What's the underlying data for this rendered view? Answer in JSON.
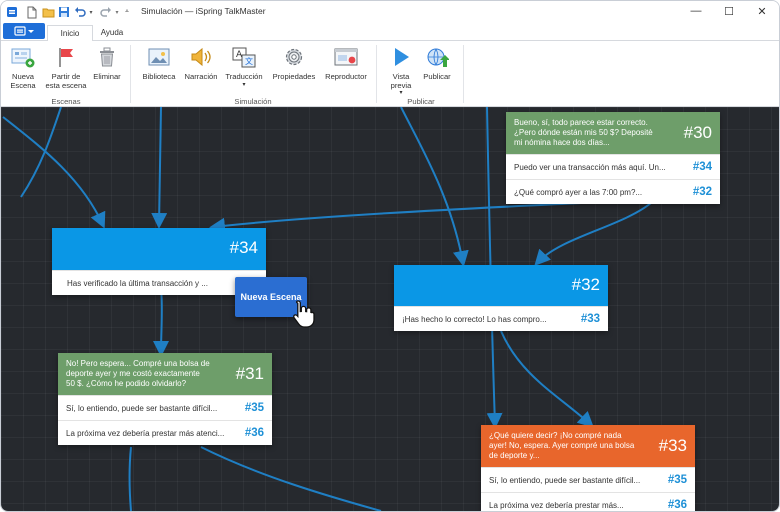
{
  "window": {
    "title": "Simulación — iSpring TalkMaster",
    "controls": {
      "minimize": "—",
      "maximize": "☐",
      "close": "✕"
    }
  },
  "tabs": [
    {
      "label": "Inicio"
    },
    {
      "label": "Ayuda"
    }
  ],
  "ribbon": {
    "groups": {
      "escenas": "Escenas",
      "simulacion": "Simulación",
      "publicar": "Publicar"
    },
    "buttons": {
      "nueva_escena": [
        "Nueva",
        "Escena"
      ],
      "partir": [
        "Partir de",
        "esta escena"
      ],
      "eliminar": [
        "Eliminar",
        ""
      ],
      "biblioteca": "Biblioteca",
      "narracion": "Narración",
      "traduccion": "Traducción",
      "propiedades": "Propiedades",
      "reproductor": "Reproductor",
      "vista_previa": [
        "Vista",
        "previa"
      ],
      "publicar": "Publicar"
    }
  },
  "nodes": {
    "n30": {
      "number": "#30",
      "text": [
        "Bueno, sí, todo parece estar correcto.",
        "¿Pero dónde están mis 50 $? Depositè",
        "mi nómina hace dos días..."
      ],
      "rows": [
        {
          "text": "Puedo ver una transacción más aquí. Un...",
          "link": "#34"
        },
        {
          "text": "¿Qué compró ayer a las 7:00 pm?...",
          "link": "#32"
        }
      ]
    },
    "n34": {
      "number": "#34",
      "rows": [
        {
          "text": "Has verificado la última transacción y ...",
          "link": ""
        }
      ]
    },
    "n32": {
      "number": "#32",
      "rows": [
        {
          "text": "¡Has hecho lo correcto! Lo has compro...",
          "link": "#33"
        }
      ]
    },
    "n31": {
      "number": "#31",
      "text": [
        "No! Pero espera... Compré una bolsa de",
        "deporte ayer y me costó exactamente",
        "50 $. ¿Cómo he podido olvidarlo?"
      ],
      "rows": [
        {
          "text": "Sí, lo entiendo, puede ser bastante difícil...",
          "link": "#35"
        },
        {
          "text": "La próxima vez debería prestar más atenci...",
          "link": "#36"
        }
      ]
    },
    "n33": {
      "number": "#33",
      "text": [
        "¿Qué quiere decir? ¡No compré nada",
        "ayer! No, espera. Ayer compré una bolsa",
        "de deporte y..."
      ],
      "rows": [
        {
          "text": "Sí, lo entiendo, puede ser bastante difícil...",
          "link": "#35"
        },
        {
          "text": "La próxima vez debería prestar más...",
          "link": "#36"
        }
      ]
    }
  },
  "drag_button": {
    "label": "Nueva Escena"
  },
  "colors": {
    "accent": "#0a97e6",
    "green_node": "#6e9e6a",
    "orange_node": "#e8662c",
    "link_line": "#1f7fc4",
    "canvas": "#26292e"
  }
}
